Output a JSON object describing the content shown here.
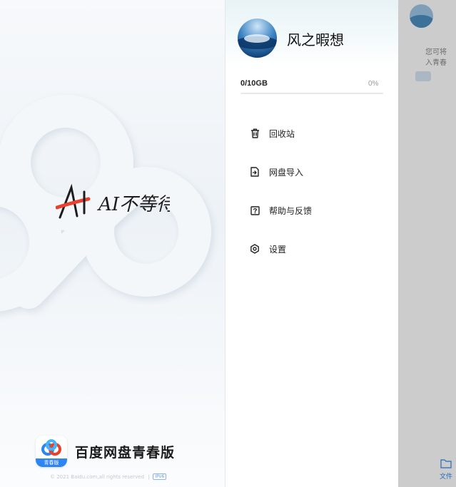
{
  "splash": {
    "slogan_text": "AI不等待",
    "brand_name": "百度网盘青春版",
    "logo_badge": "青春版",
    "copyright": "© 2021 Baidu.com,all rights reserved",
    "icp": "IPv6"
  },
  "drawer": {
    "username": "风之暇想",
    "storage": {
      "used_text": "0/10GB",
      "percent_text": "0%",
      "fraction": 0
    },
    "menu": [
      {
        "label": "回收站",
        "icon": "trash-icon"
      },
      {
        "label": "网盘导入",
        "icon": "import-icon"
      },
      {
        "label": "帮助与反馈",
        "icon": "help-icon"
      },
      {
        "label": "设置",
        "icon": "settings-icon"
      }
    ]
  },
  "background_app": {
    "notice_line1": "您可将",
    "notice_line2": "入青春",
    "tab_files": "文件"
  },
  "colors": {
    "accent": "#2e84f0",
    "scrim": "rgba(0,0,0,0.2)"
  }
}
